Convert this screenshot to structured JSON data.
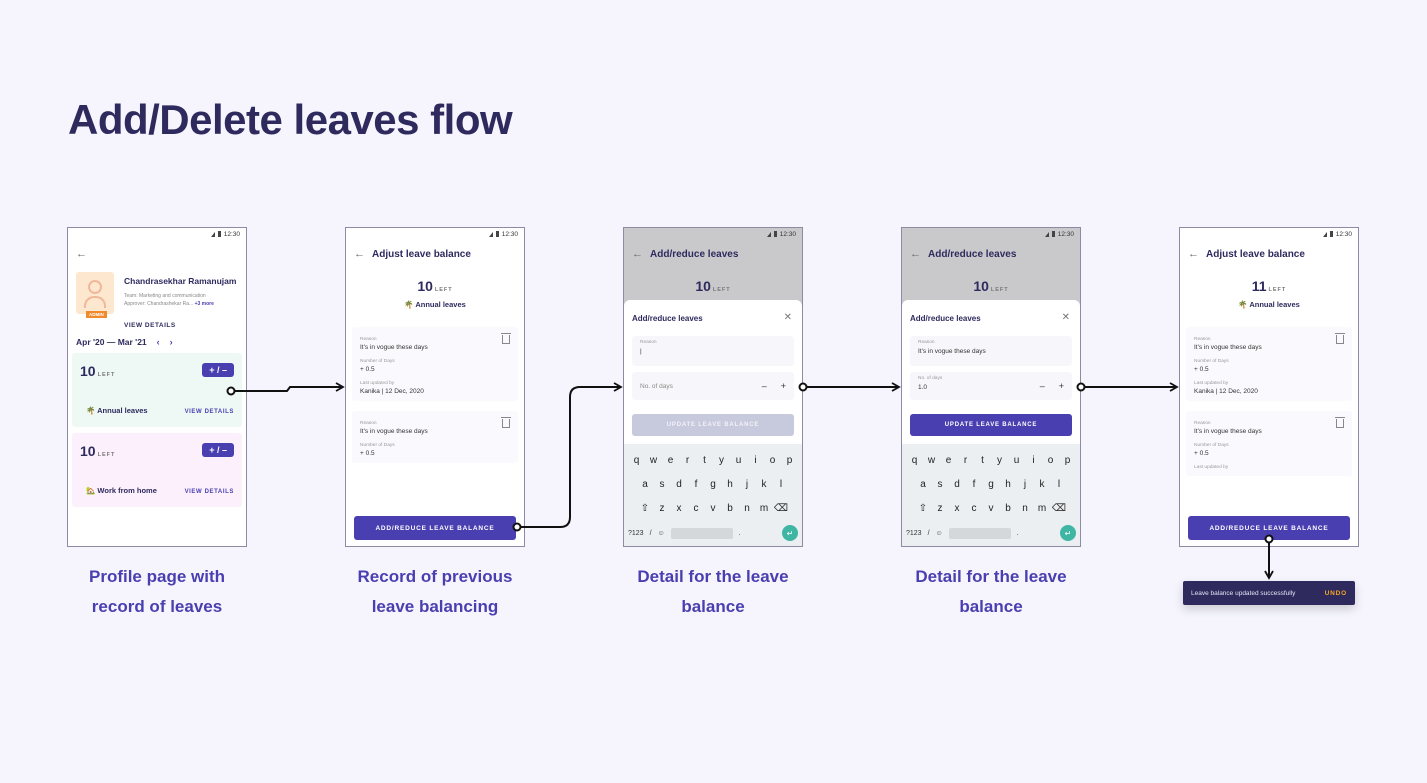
{
  "title": "Add/Delete leaves flow",
  "status_time": "12:30",
  "screen1": {
    "name": "Chandrasekhar Ramanujam",
    "team": "Team: Marketing and communication",
    "approver": "Approver: Chandrashekar Ra...",
    "more": "+3 more",
    "badge": "ADMIN",
    "view_details": "VIEW DETAILS",
    "date_range": "Apr '20 — Mar '21",
    "cards": [
      {
        "count": "10",
        "left": "LEFT",
        "button": "+ / –",
        "type": "🌴 Annual leaves",
        "view": "VIEW DETAILS"
      },
      {
        "count": "10",
        "left": "LEFT",
        "button": "+ / –",
        "type": "🏡 Work from home",
        "view": "VIEW DETAILS"
      }
    ],
    "caption_line1": "Profile page with",
    "caption_line2": "record of leaves"
  },
  "screen2": {
    "title": "Adjust leave balance",
    "count": "10",
    "left": "LEFT",
    "leave_type": "🌴 Annual leaves",
    "records": [
      {
        "reason_label": "Reason",
        "reason": "It's in vogue these days",
        "days_label": "Number of Days",
        "days": "+ 0.5",
        "updated_label": "Last updated by",
        "updated": "Kanika | 12 Dec, 2020"
      },
      {
        "reason_label": "Reason",
        "reason": "It's in vogue these days",
        "days_label": "Number of Days",
        "days": "+ 0.5"
      }
    ],
    "button": "ADD/REDUCE LEAVE BALANCE",
    "caption_line1": "Record of previous",
    "caption_line2": "leave balancing"
  },
  "screen3": {
    "title": "Add/reduce leaves",
    "count": "10",
    "left": "LEFT",
    "sheet_title": "Add/reduce leaves",
    "reason_label": "Reason",
    "reason_value": "|",
    "days_label": "No. of days",
    "minus": "–",
    "plus": "+",
    "button": "UPDATE LEAVE BALANCE",
    "caption_line1": "Detail for the leave",
    "caption_line2": "balance"
  },
  "screen4": {
    "title": "Add/reduce leaves",
    "count": "10",
    "left": "LEFT",
    "sheet_title": "Add/reduce leaves",
    "reason_label": "Reason",
    "reason_value": "It's in vogue these days",
    "days_label": "No. of days",
    "days_value": "1.0",
    "minus": "–",
    "plus": "+",
    "button": "UPDATE LEAVE BALANCE",
    "caption_line1": "Detail for the leave",
    "caption_line2": "balance"
  },
  "screen5": {
    "title": "Adjust leave balance",
    "count": "11",
    "left": "LEFT",
    "leave_type": "🌴 Annual leaves",
    "records": [
      {
        "reason_label": "Reason",
        "reason": "It's in vogue these days",
        "days_label": "Number of Days",
        "days": "+ 0.5",
        "updated_label": "Last updated by",
        "updated": "Kanika | 12 Dec, 2020"
      },
      {
        "reason_label": "Reason",
        "reason": "It's in vogue these days",
        "days_label": "Number of Days",
        "days": "+ 0.5",
        "updated_label": "Last updated by"
      }
    ],
    "button": "ADD/REDUCE LEAVE BALANCE"
  },
  "keyboard": {
    "row1": [
      "q",
      "w",
      "e",
      "r",
      "t",
      "y",
      "u",
      "i",
      "o",
      "p"
    ],
    "row2": [
      "a",
      "s",
      "d",
      "f",
      "g",
      "h",
      "j",
      "k",
      "l"
    ],
    "row3": [
      "⇧",
      "z",
      "x",
      "c",
      "v",
      "b",
      "n",
      "m",
      "⌫"
    ],
    "sym": "?123",
    "slash": "/",
    "emoji": "☺",
    "dot": ".",
    "enter": "↵"
  },
  "snackbar": {
    "message": "Leave balance updated successfully",
    "action": "UNDO"
  }
}
